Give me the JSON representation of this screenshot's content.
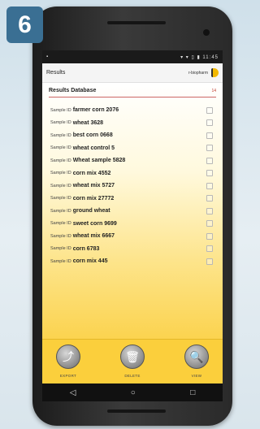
{
  "step_badge": "6",
  "status_bar": {
    "left": "▪",
    "right": "▾ ▾ ▯ ▮ 11:45"
  },
  "app_bar": {
    "title": "Results",
    "brand": "r-biopharm"
  },
  "database": {
    "title": "Results Database",
    "count": "14"
  },
  "samples": [
    {
      "prefix": "Sample ID",
      "name": "farmer corn 2076"
    },
    {
      "prefix": "Sample ID",
      "name": "wheat 3628"
    },
    {
      "prefix": "Sample ID",
      "name": "best corn 0668"
    },
    {
      "prefix": "Sample ID",
      "name": "wheat control 5"
    },
    {
      "prefix": "Sample ID",
      "name": "Wheat sample 5828"
    },
    {
      "prefix": "Sample ID",
      "name": "corn mix 4552"
    },
    {
      "prefix": "Sample ID",
      "name": "wheat mix 5727"
    },
    {
      "prefix": "Sample ID",
      "name": "corn mix 27772"
    },
    {
      "prefix": "Sample ID",
      "name": "ground wheat"
    },
    {
      "prefix": "Sample ID",
      "name": "sweet corn 9699"
    },
    {
      "prefix": "Sample ID",
      "name": "wheat mix 6667"
    },
    {
      "prefix": "Sample ID",
      "name": "corn 6783"
    },
    {
      "prefix": "Sample ID",
      "name": "corn mix 445"
    }
  ],
  "actions": {
    "export_label": "EXPORT",
    "delete_label": "DELETE",
    "view_label": "VIEW",
    "export_icon": "⤴",
    "delete_icon": "🗑",
    "view_icon": "🔍"
  },
  "nav": {
    "back_icon": "◁",
    "home_icon": "○",
    "recents_icon": "□"
  },
  "colors": {
    "accent_yellow": "#fbcf3c",
    "badge_blue": "#3a6f93",
    "count_red": "#c0392b"
  }
}
